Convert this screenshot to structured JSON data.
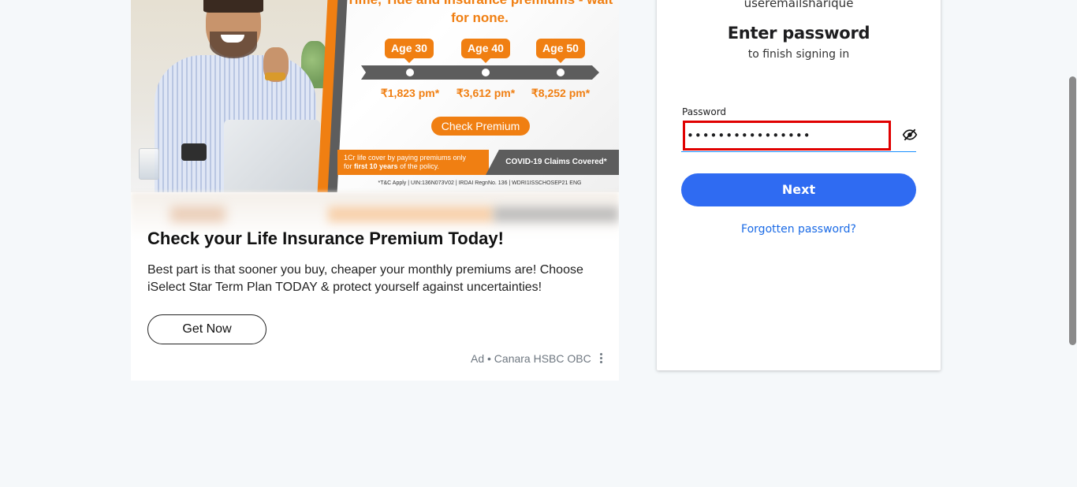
{
  "ad": {
    "banner": {
      "tagline": "Time, Tide and Insurance premiums - wait for none.",
      "ages": [
        "Age 30",
        "Age 40",
        "Age 50"
      ],
      "prices": [
        "₹1,823 pm*",
        "₹3,612 pm*",
        "₹8,252 pm*"
      ],
      "check_premium": "Check Premium",
      "cover_text_line1": "1Cr life cover by paying premiums only",
      "cover_text_line2_prefix": "for ",
      "cover_text_line2_bold": "first 10 years",
      "cover_text_line2_suffix": " of the policy.",
      "covid_text": "COVID-19 Claims Covered*",
      "tc_text": "*T&C Apply | UIN:136N073V02 | IRDAI RegnNo. 136 | WDRI1ISSCHOSEP21 ENG"
    },
    "title": "Check your Life Insurance Premium Today!",
    "description": "Best part is that sooner you buy, cheaper your monthly premiums are! Choose iSelect Star Term Plan TODAY & protect yourself against uncertainties!",
    "cta_label": "Get Now",
    "source": "Ad • Canara HSBC OBC",
    "menu_icon": "more-vertical-icon"
  },
  "login": {
    "username": "useremailsharique",
    "title": "Enter password",
    "subtitle": "to finish signing in",
    "password_label": "Password",
    "password_value": "••••••••••••••••",
    "eye_icon": "eye-slash-icon",
    "next_label": "Next",
    "forgot_label": "Forgotten password?"
  },
  "colors": {
    "accent": "#2f6bf2",
    "link": "#1b6be6",
    "highlight_border": "#e00000",
    "ad_orange": "#f07f12"
  }
}
